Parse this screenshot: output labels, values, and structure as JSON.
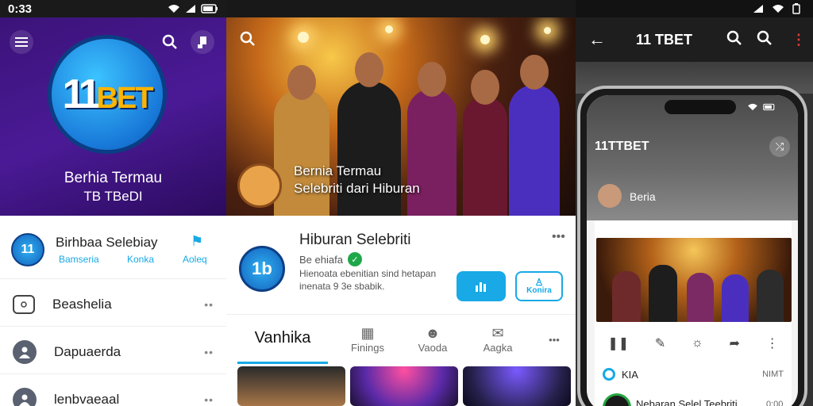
{
  "left": {
    "status_time": "0:33",
    "logo_number": "11",
    "logo_text": "BET",
    "hero_title_line1": "Berhia Termau",
    "hero_title_line2": "TB TBeDI",
    "profile": {
      "name": "Birhbaa Selebiay",
      "actions": [
        "Bamseria",
        "Konka",
        "Aoleq"
      ]
    },
    "menu": [
      {
        "label": "Beashelia",
        "icon": "camera-icon"
      },
      {
        "label": "Dapuaerda",
        "icon": "user-icon"
      },
      {
        "label": "lenbvaeaal",
        "icon": "user-group-icon"
      }
    ]
  },
  "center": {
    "caption_line1": "Bernia Termau",
    "caption_line2": "Selebriti dari Hiburan",
    "title": "Hiburan Selebriti",
    "subtitle": "Be ehiafa",
    "description_line1": "Hienoata ebenitian sind hetapan",
    "description_line2": "inenata 9 3e sbabik.",
    "logo_number": "1b",
    "primary_button": "",
    "secondary_button": "Konira",
    "tabs": [
      "Vanhika",
      "Finings",
      "Vaoda",
      "Aagka"
    ]
  },
  "right": {
    "app_title": "11 TBET",
    "phone": {
      "app_title": "11TTBET",
      "section_label": "Beria",
      "toggle_label": "KIA",
      "toggle_right": "NIMT",
      "item_title": "Nebaran Selel Teebriti",
      "item_time": "0:00"
    }
  },
  "colors": {
    "accent": "#18a9e6",
    "purple": "#3b0f7a",
    "brand_gold": "#ffb400"
  }
}
